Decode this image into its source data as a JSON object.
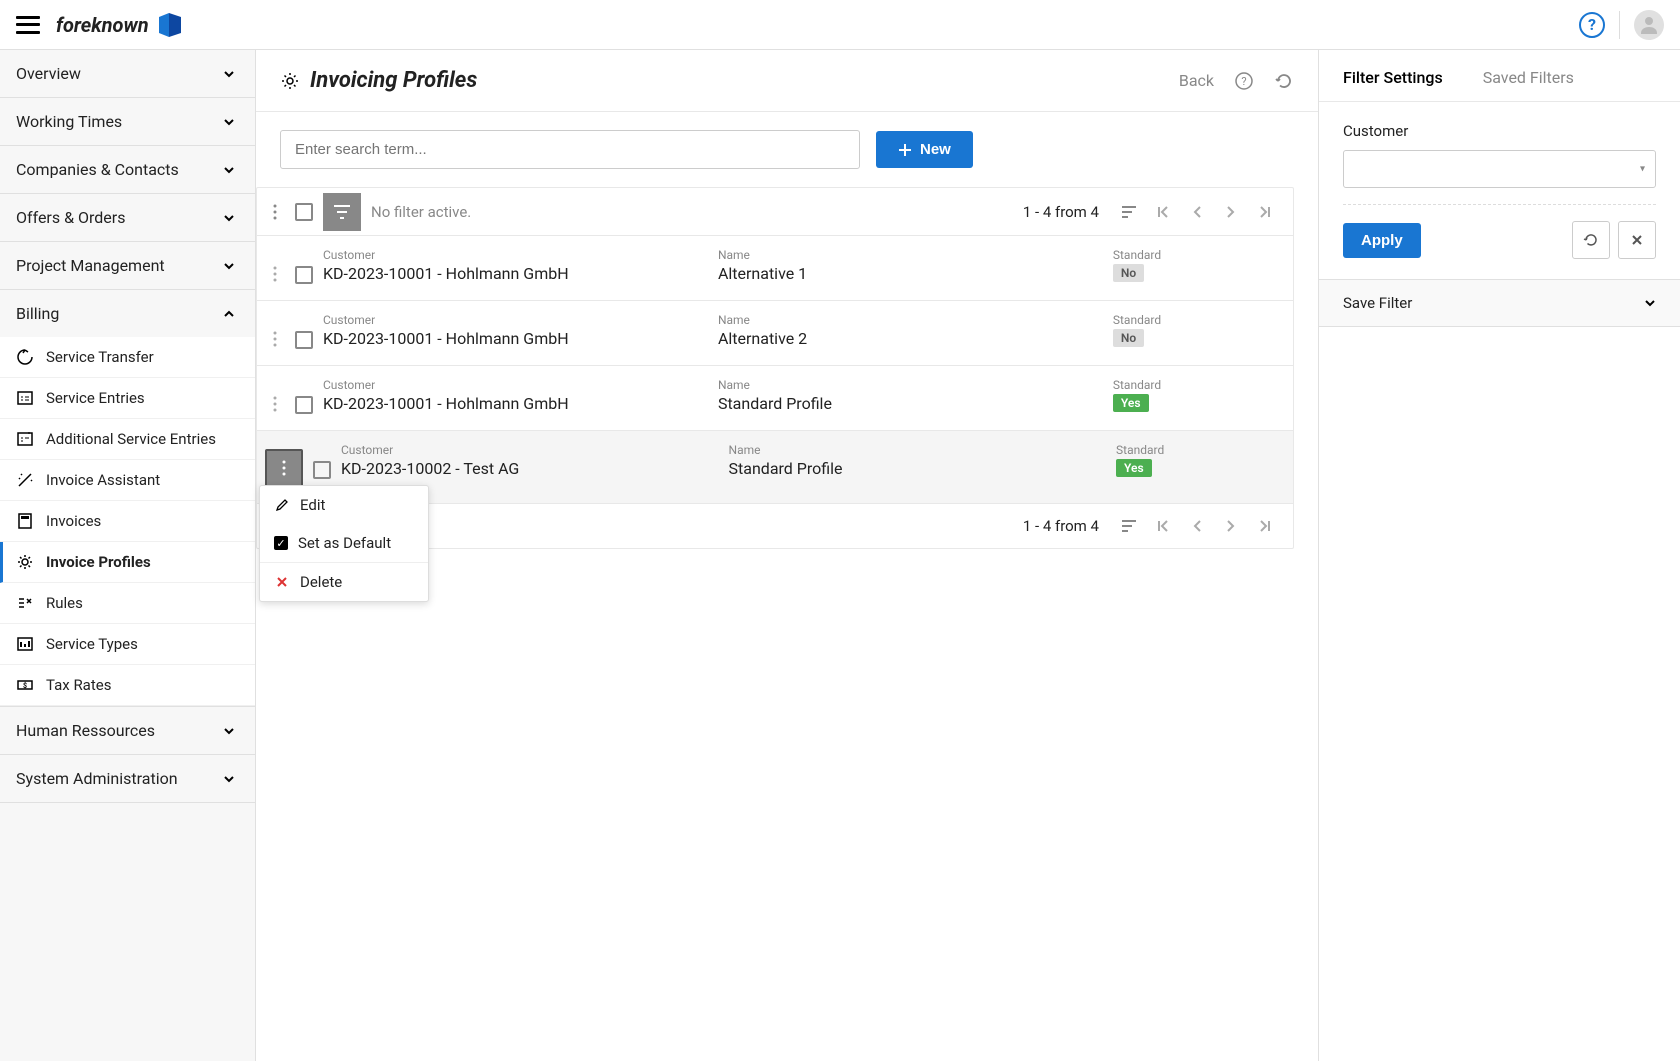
{
  "brand": "foreknown",
  "topbar": {
    "help_label": "?",
    "help_aria": "Help"
  },
  "sidebar": {
    "sections": [
      {
        "label": "Overview",
        "expanded": false
      },
      {
        "label": "Working Times",
        "expanded": false
      },
      {
        "label": "Companies & Contacts",
        "expanded": false
      },
      {
        "label": "Offers & Orders",
        "expanded": false
      },
      {
        "label": "Project Management",
        "expanded": false
      },
      {
        "label": "Billing",
        "expanded": true
      },
      {
        "label": "Human Ressources",
        "expanded": false
      },
      {
        "label": "System Administration",
        "expanded": false
      }
    ],
    "billing_items": [
      {
        "label": "Service Transfer",
        "icon": "transfer"
      },
      {
        "label": "Service Entries",
        "icon": "entries"
      },
      {
        "label": "Additional Service Entries",
        "icon": "entries-plus"
      },
      {
        "label": "Invoice Assistant",
        "icon": "wand"
      },
      {
        "label": "Invoices",
        "icon": "calculator"
      },
      {
        "label": "Invoice Profiles",
        "icon": "gear",
        "active": true
      },
      {
        "label": "Rules",
        "icon": "rules"
      },
      {
        "label": "Service Types",
        "icon": "types"
      },
      {
        "label": "Tax Rates",
        "icon": "money"
      }
    ]
  },
  "header": {
    "title": "Invoicing Profiles",
    "back": "Back"
  },
  "toolbar": {
    "search_placeholder": "Enter search term...",
    "new_label": "New"
  },
  "list": {
    "filter_status": "No filter active.",
    "pagination": "1 - 4 from 4",
    "col_customer": "Customer",
    "col_name": "Name",
    "col_standard": "Standard",
    "badge_yes": "Yes",
    "badge_no": "No",
    "rows": [
      {
        "customer": "KD-2023-10001 - Hohlmann GmbH",
        "name": "Alternative 1",
        "standard": false
      },
      {
        "customer": "KD-2023-10001 - Hohlmann GmbH",
        "name": "Alternative 2",
        "standard": false
      },
      {
        "customer": "KD-2023-10001 - Hohlmann GmbH",
        "name": "Standard Profile",
        "standard": true
      },
      {
        "customer": "KD-2023-10002 - Test AG",
        "name": "Standard Profile",
        "standard": true,
        "highlighted": true,
        "menu_open": true
      }
    ]
  },
  "context_menu": {
    "edit": "Edit",
    "set_default": "Set as Default",
    "delete": "Delete"
  },
  "filter": {
    "tab_settings": "Filter Settings",
    "tab_saved": "Saved Filters",
    "customer_label": "Customer",
    "apply": "Apply",
    "save_filter": "Save Filter"
  }
}
